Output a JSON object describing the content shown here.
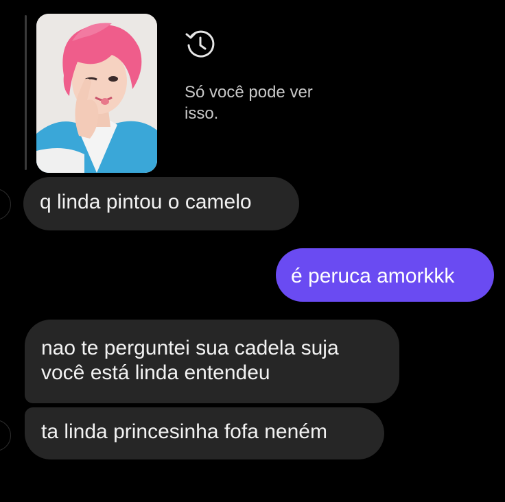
{
  "chat": {
    "vanish_notice": "Só você pode ver isso.",
    "icons": {
      "vanish": "history-clock-icon",
      "photo": "shared-photo"
    },
    "colors": {
      "background": "#000000",
      "incoming_bubble": "#262626",
      "outgoing_bubble": "#6a4bf2",
      "text": "#f2f2f2",
      "notice_text": "#c9c9c9"
    },
    "messages": [
      {
        "direction": "incoming",
        "text": "q linda pintou o camelo"
      },
      {
        "direction": "outgoing",
        "text": "é peruca amorkkk"
      },
      {
        "direction": "incoming",
        "text": "nao te perguntei sua cadela suja você está linda entendeu"
      },
      {
        "direction": "incoming",
        "text": "ta linda princesinha fofa neném"
      }
    ]
  }
}
